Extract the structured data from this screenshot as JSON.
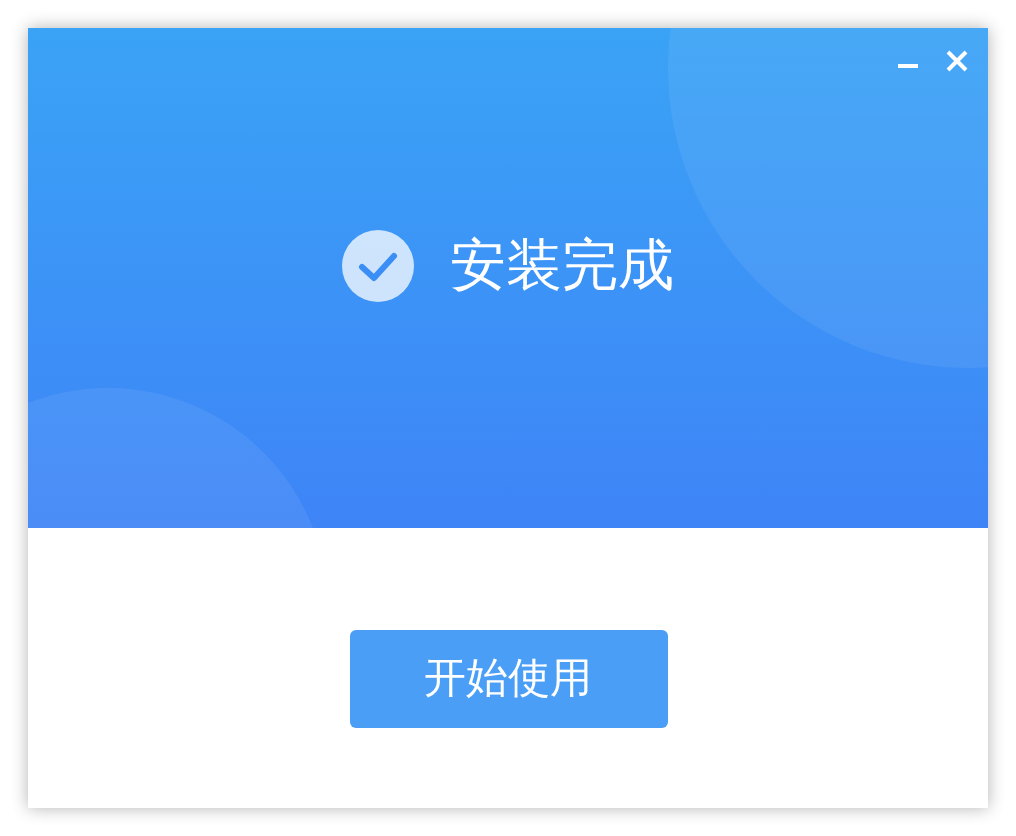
{
  "window": {
    "controls": [
      {
        "kind": "minimize"
      },
      {
        "kind": "close"
      }
    ]
  },
  "status": {
    "title": "安装完成",
    "done": true
  },
  "button": {
    "label": "开始使用"
  }
}
